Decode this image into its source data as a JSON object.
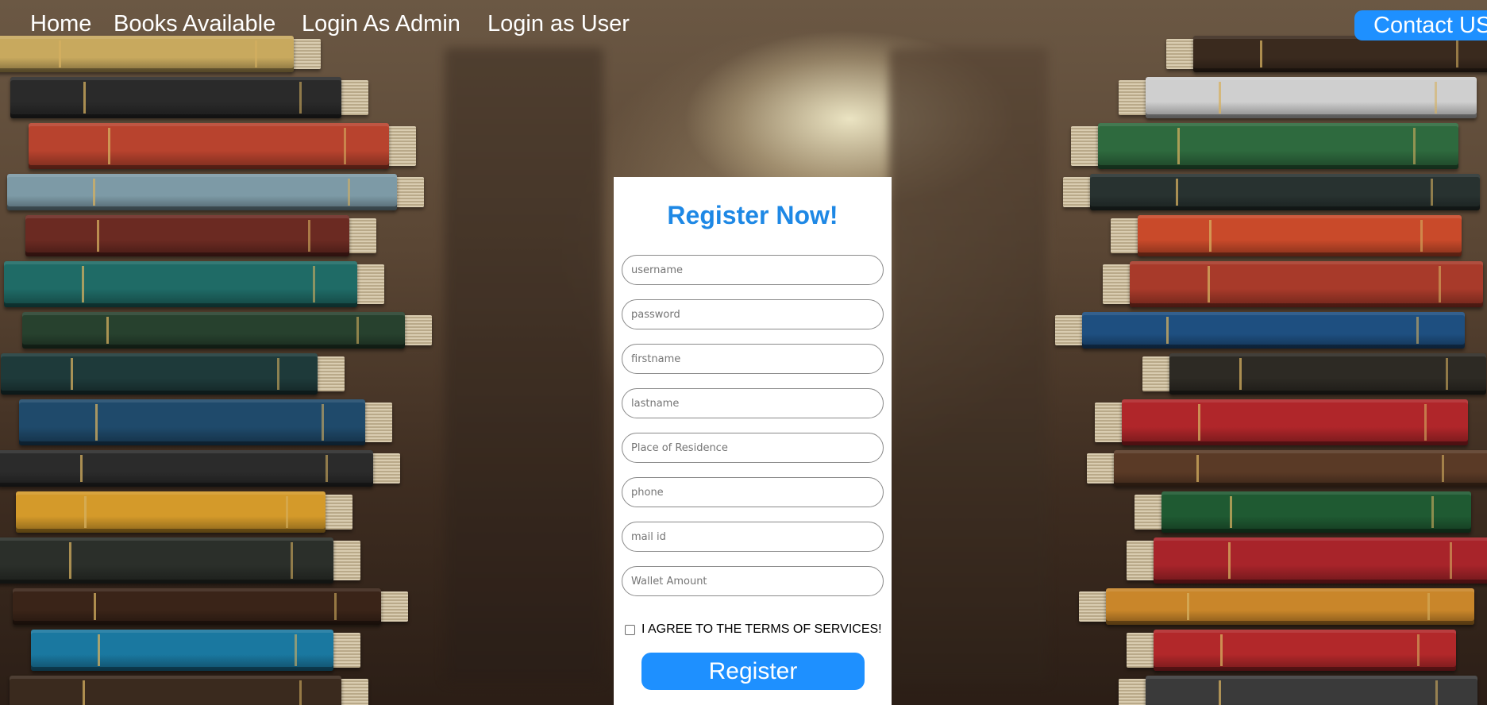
{
  "nav": {
    "links": [
      "Home",
      "Books Available",
      "Login As Admin",
      "Login as User"
    ],
    "contact_label": "Contact US"
  },
  "form": {
    "title": "Register Now!",
    "placeholders": {
      "username": "username",
      "password": "password",
      "firstname": "firstname",
      "lastname": "lastname",
      "residence": "Place of Residence",
      "phone": "phone",
      "mail": "mail id",
      "wallet": "Wallet Amount"
    },
    "terms_label": "I AGREE TO THE TERMS OF SERVICES!",
    "terms_checked": false,
    "register_label": "Register"
  },
  "colors": {
    "accent": "#1e90ff",
    "title": "#1e88e5",
    "nav_text": "#ffffff"
  }
}
